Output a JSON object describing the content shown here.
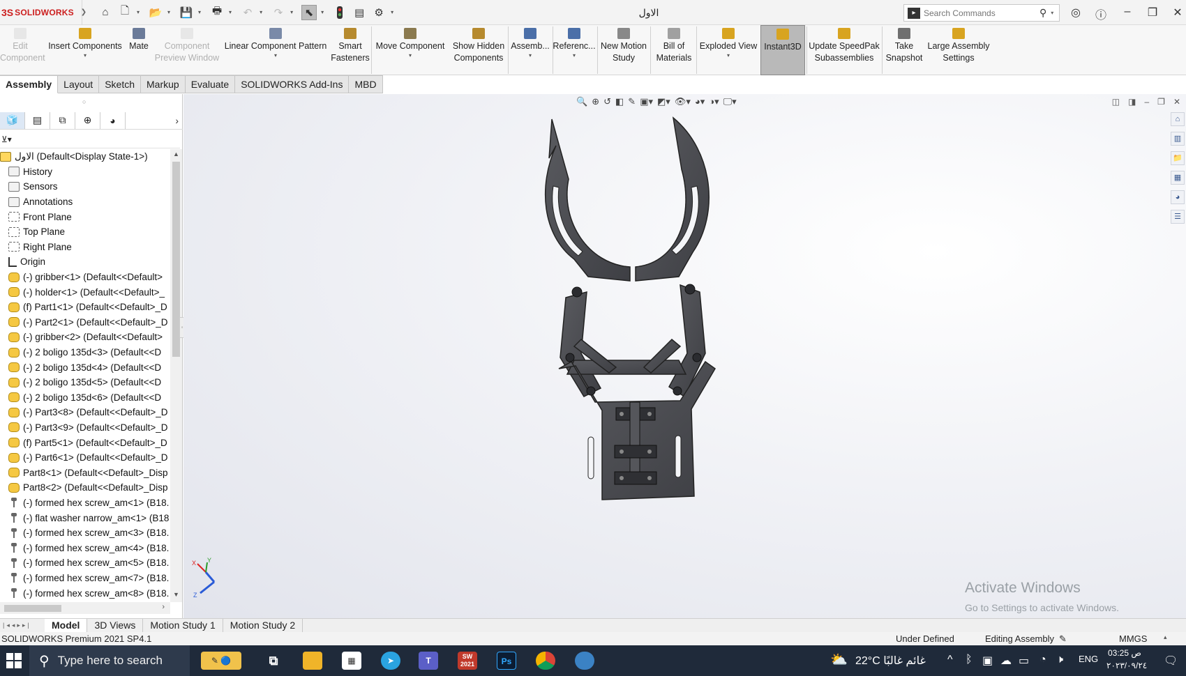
{
  "titlebar": {
    "brand": "SOLIDWORKS",
    "doc_title": "الاول",
    "search_placeholder": "Search Commands"
  },
  "command_manager": {
    "commands": [
      {
        "label": "Edit\nComponent",
        "enabled": false
      },
      {
        "label": "Insert Components",
        "enabled": true
      },
      {
        "label": "Mate",
        "enabled": true
      },
      {
        "label": "Component\nPreview Window",
        "enabled": false
      },
      {
        "label": "Linear Component Pattern",
        "enabled": true
      },
      {
        "label": "Smart\nFasteners",
        "enabled": true
      },
      {
        "label": "Move Component",
        "enabled": true
      },
      {
        "label": "Show Hidden\nComponents",
        "enabled": true
      },
      {
        "label": "Assemb...",
        "enabled": true
      },
      {
        "label": "Referenc...",
        "enabled": true
      },
      {
        "label": "New Motion\nStudy",
        "enabled": true
      },
      {
        "label": "Bill of\nMaterials",
        "enabled": true
      },
      {
        "label": "Exploded View",
        "enabled": true
      },
      {
        "label": "Instant3D",
        "enabled": true,
        "pressed": true
      },
      {
        "label": "Update SpeedPak\nSubassemblies",
        "enabled": true
      },
      {
        "label": "Take\nSnapshot",
        "enabled": true
      },
      {
        "label": "Large Assembly\nSettings",
        "enabled": true
      }
    ]
  },
  "tabs": [
    "Assembly",
    "Layout",
    "Sketch",
    "Markup",
    "Evaluate",
    "SOLIDWORKS Add-Ins",
    "MBD"
  ],
  "active_tab": "Assembly",
  "feature_tree": {
    "root": "الاول  (Default<Display State-1>)",
    "items": [
      {
        "label": "History",
        "icon": "history-icon"
      },
      {
        "label": "Sensors",
        "icon": "sensors-icon"
      },
      {
        "label": "Annotations",
        "icon": "annotations-icon"
      },
      {
        "label": "Front Plane",
        "icon": "plane-icon"
      },
      {
        "label": "Top Plane",
        "icon": "plane-icon"
      },
      {
        "label": "Right Plane",
        "icon": "plane-icon"
      },
      {
        "label": "Origin",
        "icon": "origin-icon"
      },
      {
        "label": "(-) gribber<1> (Default<<Default>",
        "icon": "part-icon"
      },
      {
        "label": "(-) holder<1> (Default<<Default>_",
        "icon": "part-icon"
      },
      {
        "label": "(f) Part1<1> (Default<<Default>_D",
        "icon": "part-icon"
      },
      {
        "label": "(-) Part2<1> (Default<<Default>_D",
        "icon": "part-icon"
      },
      {
        "label": "(-) gribber<2> (Default<<Default>",
        "icon": "part-icon"
      },
      {
        "label": "(-) 2 boligo 135d<3> (Default<<D",
        "icon": "part-icon"
      },
      {
        "label": "(-) 2 boligo 135d<4> (Default<<D",
        "icon": "part-icon"
      },
      {
        "label": "(-) 2 boligo 135d<5> (Default<<D",
        "icon": "part-icon"
      },
      {
        "label": "(-) 2 boligo 135d<6> (Default<<D",
        "icon": "part-icon"
      },
      {
        "label": "(-) Part3<8> (Default<<Default>_D",
        "icon": "part-icon"
      },
      {
        "label": "(-) Part3<9> (Default<<Default>_D",
        "icon": "part-icon"
      },
      {
        "label": "(f) Part5<1> (Default<<Default>_D",
        "icon": "part-icon"
      },
      {
        "label": "(-) Part6<1> (Default<<Default>_D",
        "icon": "part-icon"
      },
      {
        "label": "Part8<1> (Default<<Default>_Disp",
        "icon": "part-icon"
      },
      {
        "label": "Part8<2> (Default<<Default>_Disp",
        "icon": "part-icon"
      },
      {
        "label": "(-) formed hex screw_am<1> (B18.",
        "icon": "screw-icon"
      },
      {
        "label": "(-) flat washer narrow_am<1> (B18",
        "icon": "screw-icon"
      },
      {
        "label": "(-) formed hex screw_am<3> (B18.",
        "icon": "screw-icon"
      },
      {
        "label": "(-) formed hex screw_am<4> (B18.",
        "icon": "screw-icon"
      },
      {
        "label": "(-) formed hex screw_am<5> (B18.",
        "icon": "screw-icon"
      },
      {
        "label": "(-) formed hex screw_am<7> (B18.",
        "icon": "screw-icon"
      },
      {
        "label": "(-) formed hex screw_am<8> (B18.",
        "icon": "screw-icon"
      }
    ]
  },
  "triad_labels": {
    "x": "X",
    "y": "Y",
    "z": "Z"
  },
  "watermark": {
    "line1": "Activate Windows",
    "line2": "Go to Settings to activate Windows."
  },
  "bottom_tabs": [
    "Model",
    "3D Views",
    "Motion Study 1",
    "Motion Study 2"
  ],
  "active_bottom_tab": "Model",
  "status": {
    "product": "SOLIDWORKS Premium 2021 SP4.1",
    "state": "Under Defined",
    "mode": "Editing Assembly",
    "units": "MMGS"
  },
  "taskbar": {
    "search_placeholder": "Type here to search",
    "weather": "22°C  غائم غالبًا",
    "lang": "ENG",
    "time": "03:25 ص",
    "date": "٢٠٢٣/٠٩/٢٤",
    "sw_badge": "SW\n2021",
    "ps_badge": "Ps"
  },
  "colors": {
    "brand_red": "#cc1f1f",
    "model_gray": "#4a4b50",
    "taskbar": "#1f2a3a"
  }
}
